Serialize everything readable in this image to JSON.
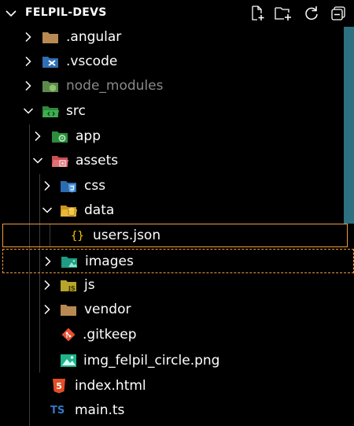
{
  "header": {
    "title": "FELPIL-DEVS",
    "actions": [
      "new-file-icon",
      "new-folder-icon",
      "refresh-icon",
      "collapse-all-icon"
    ]
  },
  "tree": [
    {
      "label": ".angular",
      "icon": "folder-angular-icon",
      "expanded": false
    },
    {
      "label": ".vscode",
      "icon": "folder-vscode-icon",
      "expanded": false
    },
    {
      "label": "node_modules",
      "icon": "folder-node-icon",
      "expanded": false,
      "dimmed": true
    },
    {
      "label": "src",
      "icon": "folder-src-icon",
      "expanded": true
    },
    {
      "label": "app",
      "icon": "folder-app-icon",
      "expanded": false
    },
    {
      "label": "assets",
      "icon": "folder-assets-icon",
      "expanded": true
    },
    {
      "label": "css",
      "icon": "folder-css-icon",
      "expanded": false
    },
    {
      "label": "data",
      "icon": "folder-data-icon",
      "expanded": true
    },
    {
      "label": "users.json",
      "icon": "json-file-icon",
      "selected": true
    },
    {
      "label": "images",
      "icon": "folder-images-icon",
      "expanded": false,
      "focused": true
    },
    {
      "label": "js",
      "icon": "folder-js-icon",
      "expanded": false
    },
    {
      "label": "vendor",
      "icon": "folder-vendor-icon",
      "expanded": false
    },
    {
      "label": ".gitkeep",
      "icon": "git-file-icon"
    },
    {
      "label": "img_felpil_circle.png",
      "icon": "image-file-icon"
    },
    {
      "label": "index.html",
      "icon": "html-file-icon"
    },
    {
      "label": "main.ts",
      "icon": "typescript-file-icon",
      "icon_text": "TS"
    }
  ],
  "colors": {
    "background": "#000000",
    "selection_border": "#ee9b3c",
    "scrollbar": "#2e6f80",
    "json_icon": "#f5c400",
    "html_icon": "#e44d26",
    "ts_icon": "#3178c6"
  }
}
